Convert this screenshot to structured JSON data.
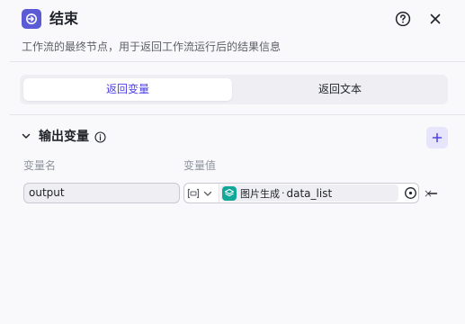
{
  "header": {
    "title": "结束",
    "description": "工作流的最终节点，用于返回工作流运行后的结果信息",
    "logo_icon": "exit-icon",
    "help_icon": "question-circle-icon",
    "close_icon": "close-icon"
  },
  "tabs": [
    {
      "label": "返回变量",
      "active": true
    },
    {
      "label": "返回文本",
      "active": false
    }
  ],
  "output_section": {
    "title": "输出变量",
    "columns": {
      "name": "变量名",
      "value": "变量值"
    },
    "rows": [
      {
        "name": "output",
        "value_type_icon": "array-type-icon",
        "ref_node": "图片生成",
        "ref_separator": "·",
        "ref_variable": "data_list",
        "clear_label": "×"
      }
    ]
  },
  "colors": {
    "accent": "#4e40e5",
    "logo_bg": "#5b5bd6",
    "node_icon_bg": "#12a899",
    "add_button_bg": "#e6e5fb"
  }
}
